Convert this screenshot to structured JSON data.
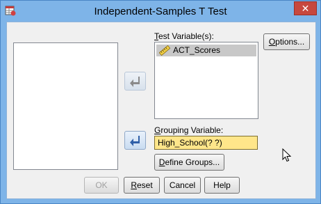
{
  "window": {
    "title": "Independent-Samples T Test",
    "close_label": "✕"
  },
  "test_variables": {
    "label_mnemonic": "T",
    "label_rest": "est Variable(s):",
    "items": [
      "ACT_Scores"
    ]
  },
  "grouping": {
    "label_mnemonic": "G",
    "label_rest": "rouping Variable:",
    "value": "High_School(? ?)"
  },
  "buttons": {
    "options_mnemonic": "O",
    "options_rest": "ptions...",
    "define_mnemonic": "D",
    "define_rest": "efine Groups...",
    "ok": "OK",
    "reset_mnemonic": "R",
    "reset_rest": "eset",
    "cancel": "Cancel",
    "help": "Help"
  },
  "colors": {
    "titlebar": "#7eb4e8",
    "close": "#c7483e",
    "grouping_field": "#ffe68a",
    "selected_item": "#c8c8c8"
  },
  "icons": {
    "app": "spss-dialog-icon",
    "variable": "ruler-scale-icon",
    "move": "curved-arrow-left-icon"
  }
}
